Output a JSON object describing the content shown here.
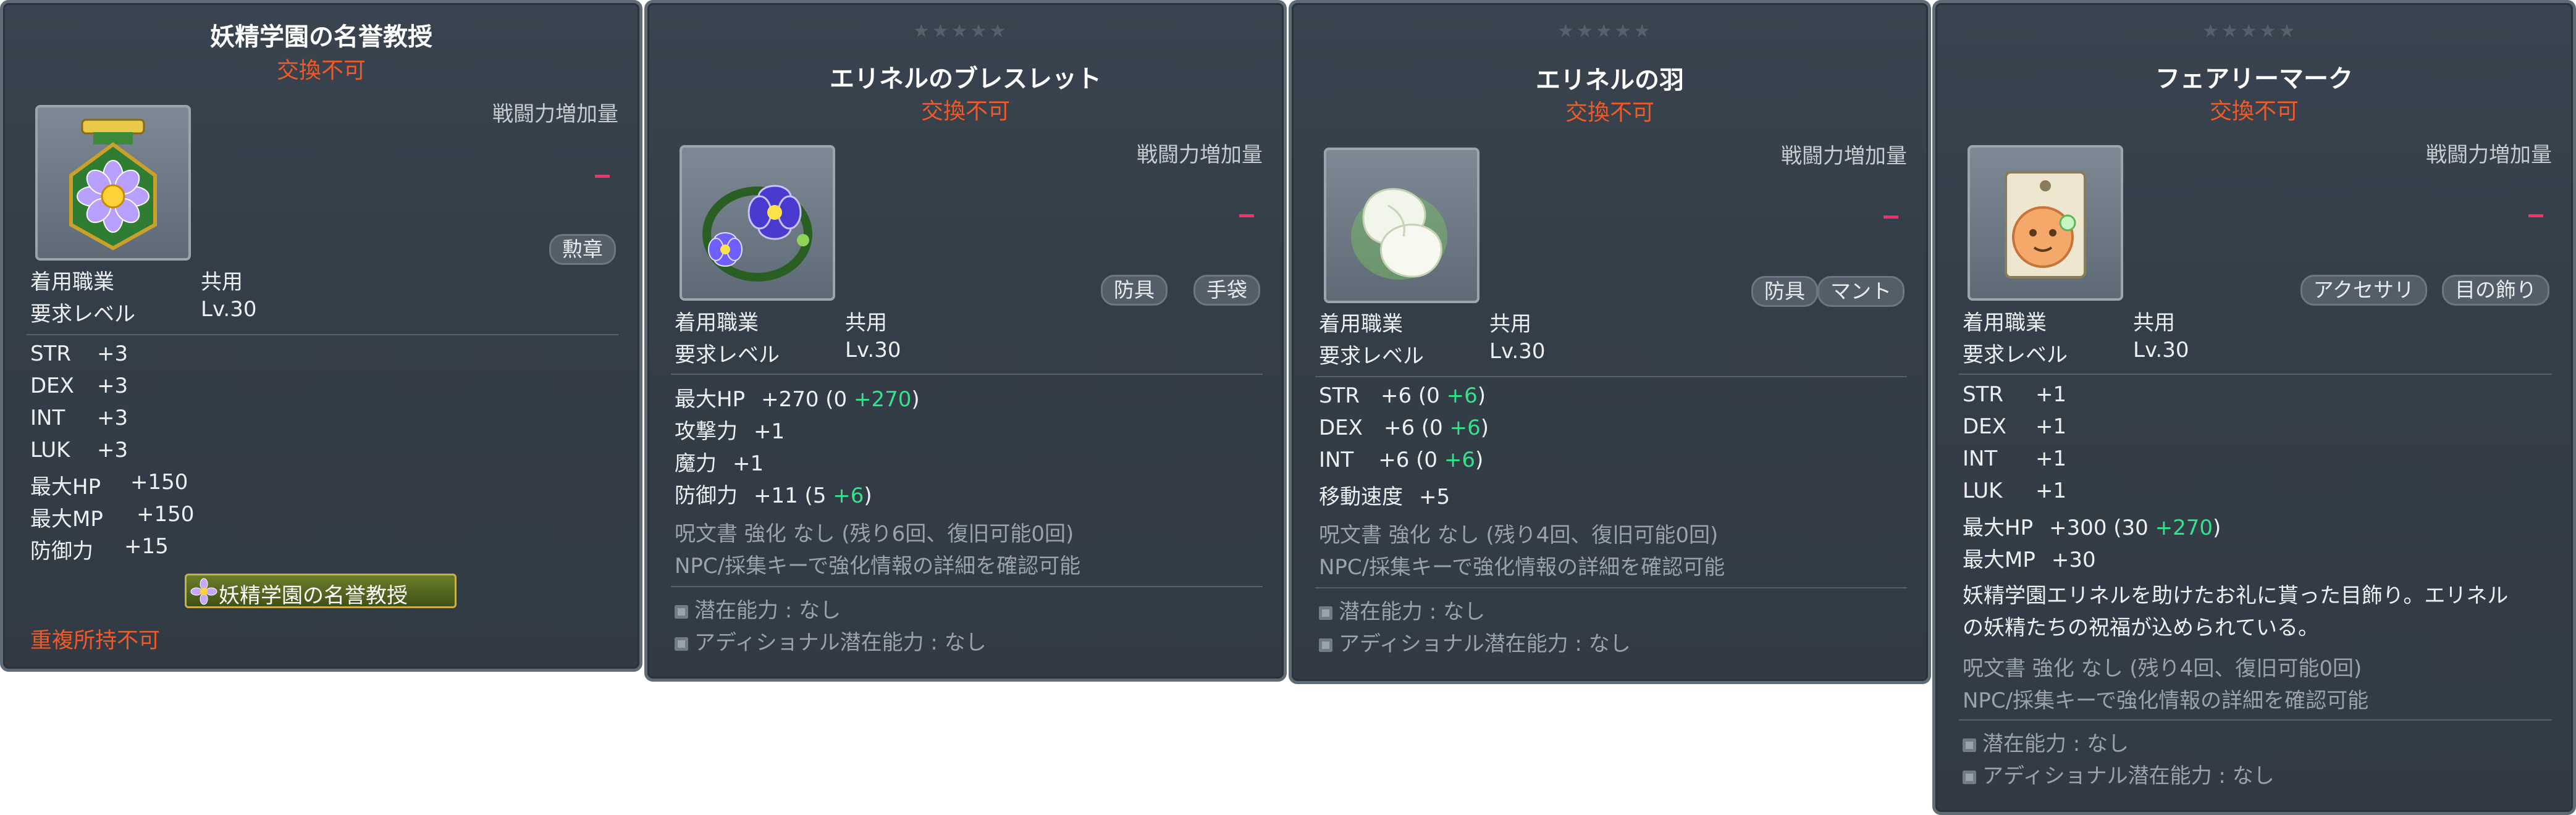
{
  "ui": {
    "untradeable": "交換不可",
    "cp_label": "戦闘力増加量",
    "stars": "★★★★★"
  },
  "cards": [
    {
      "title": "妖精学園の名誉教授",
      "tags": [
        "勲章"
      ],
      "job_label": "着用職業",
      "job_value": "共用",
      "level_label": "要求レベル",
      "level_value": "Lv.30",
      "stats": [
        {
          "name": "STR",
          "value": "+3"
        },
        {
          "name": "DEX",
          "value": "+3"
        },
        {
          "name": "INT",
          "value": "+3"
        },
        {
          "name": "LUK",
          "value": "+3"
        },
        {
          "name": "最大HP",
          "value": "+150"
        },
        {
          "name": "最大MP",
          "value": "+150"
        },
        {
          "name": "防御力",
          "value": "+15"
        }
      ],
      "banner": "妖精学園の名誉教授",
      "note": "重複所持不可"
    },
    {
      "title": "エリネルのブレスレット",
      "tags": [
        "防具",
        "手袋"
      ],
      "job_label": "着用職業",
      "job_value": "共用",
      "level_label": "要求レベル",
      "level_value": "Lv.30",
      "stats": [
        {
          "name": "最大HP",
          "value": "+270 (0 ",
          "bonus": "+270",
          "close": ")"
        },
        {
          "name": "攻撃力",
          "value": "+1"
        },
        {
          "name": "魔力",
          "value": "+1"
        },
        {
          "name": "防御力",
          "value": "+11 (5 ",
          "bonus": "+6",
          "close": ")"
        }
      ],
      "scroll": "呪文書 強化 なし (残り6回、復旧可能0回)",
      "npc": "NPC/採集キーで強化情報の詳細を確認可能",
      "potential": "潜在能力 : なし",
      "additional": "アディショナル潜在能力 : なし"
    },
    {
      "title": "エリネルの羽",
      "tags": [
        "防具",
        "マント"
      ],
      "job_label": "着用職業",
      "job_value": "共用",
      "level_label": "要求レベル",
      "level_value": "Lv.30",
      "stats": [
        {
          "name": "STR",
          "value": "+6 (0 ",
          "bonus": "+6",
          "close": ")"
        },
        {
          "name": "DEX",
          "value": "+6 (0 ",
          "bonus": "+6",
          "close": ")"
        },
        {
          "name": "INT",
          "value": "+6 (0 ",
          "bonus": "+6",
          "close": ")"
        },
        {
          "name": "移動速度",
          "value": "+5"
        }
      ],
      "scroll": "呪文書 強化 なし (残り4回、復旧可能0回)",
      "npc": "NPC/採集キーで強化情報の詳細を確認可能",
      "potential": "潜在能力 : なし",
      "additional": "アディショナル潜在能力 : なし"
    },
    {
      "title": "フェアリーマーク",
      "tags": [
        "アクセサリ",
        "目の飾り"
      ],
      "job_label": "着用職業",
      "job_value": "共用",
      "level_label": "要求レベル",
      "level_value": "Lv.30",
      "stats": [
        {
          "name": "STR",
          "value": "+1"
        },
        {
          "name": "DEX",
          "value": "+1"
        },
        {
          "name": "INT",
          "value": "+1"
        },
        {
          "name": "LUK",
          "value": "+1"
        },
        {
          "name": "最大HP",
          "value": "+300 (30 ",
          "bonus": "+270",
          "close": ")"
        },
        {
          "name": "最大MP",
          "value": "+30"
        }
      ],
      "desc1": "妖精学園エリネルを助けたお礼に貰った目飾り。エリネル",
      "desc2": "の妖精たちの祝福が込められている。",
      "scroll": "呪文書 強化 なし (残り4回、復旧可能0回)",
      "npc": "NPC/採集キーで強化情報の詳細を確認可能",
      "potential": "潜在能力 : なし",
      "additional": "アディショナル潜在能力 : なし"
    }
  ]
}
